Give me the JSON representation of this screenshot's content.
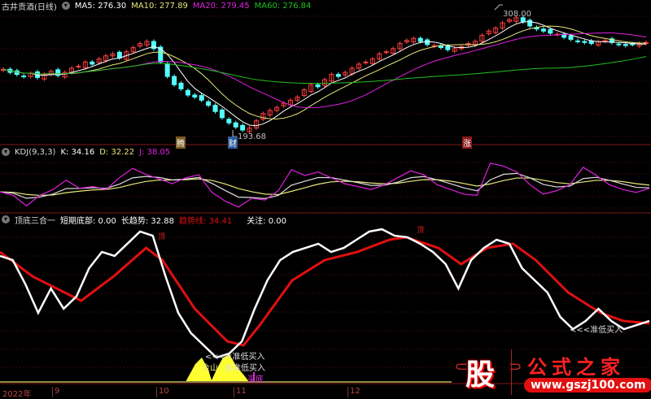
{
  "price_header": {
    "title": "古井贡酒(日线)",
    "ma5": "MA5: 276.30",
    "ma10": "MA10: 277.89",
    "ma20": "MA20: 279.45",
    "ma60": "MA60: 276.84"
  },
  "kdj_header": {
    "title": "KDJ(9,3,3)",
    "k": "K: 34.16",
    "d": "D: 32.22",
    "j": "J: 38.05"
  },
  "ind_header": {
    "title": "顶底三合一",
    "short": "短期底部: 0.00",
    "long": "长趋势: 32.88",
    "trend": "趋势线: 34.41",
    "focus": "关注: 0.00"
  },
  "markers": {
    "high": "308.00",
    "low": "193.68",
    "tag1": "腾",
    "tag2": "财",
    "tag3": "涨",
    "top1": "顶",
    "top2": "顶",
    "buy1": "<<<<准低买入",
    "buy2": "金山",
    "buy3": "金准低买入",
    "buy4": "买底",
    "buy5": "<<<准低买入"
  },
  "axis": {
    "labels": [
      "2022年",
      "9",
      "10",
      "11",
      "12"
    ]
  },
  "logo": {
    "char": "股",
    "name": "公式之家",
    "url": "www.gszj100.com"
  },
  "colors": {
    "up": "#ff4040",
    "down": "#54ffff",
    "ma5": "#ffffff",
    "ma10": "#e8e87a",
    "ma20": "#e020e0",
    "ma60": "#20c020",
    "trend": "#e01010"
  },
  "chart_data": {
    "type": "line",
    "closes": [
      255,
      252,
      250,
      248,
      251,
      247,
      250,
      253,
      249,
      252,
      256,
      258,
      262,
      260,
      265,
      268,
      270,
      266,
      272,
      276,
      280,
      282,
      275,
      262,
      248,
      240,
      236,
      230,
      228,
      225,
      220,
      214,
      208,
      203,
      199,
      196,
      198,
      205,
      212,
      215,
      218,
      222,
      225,
      228,
      235,
      240,
      238,
      245,
      250,
      248,
      252,
      256,
      260,
      262,
      265,
      270,
      272,
      275,
      280,
      283,
      285,
      282,
      279,
      278,
      276,
      274,
      275,
      277,
      280,
      282,
      288,
      292,
      295,
      300,
      303,
      305,
      301,
      297,
      294,
      292,
      290,
      289,
      286,
      284,
      282,
      281,
      280,
      282,
      283,
      281,
      279,
      278,
      279,
      280,
      281
    ],
    "price_range": [
      193.68,
      308.0
    ],
    "kdj_j": [
      36,
      30,
      12,
      30,
      40,
      56,
      42,
      45,
      40,
      60,
      76,
      66,
      58,
      50,
      60,
      65,
      35,
      20,
      10,
      25,
      22,
      38,
      74,
      64,
      70,
      60,
      50,
      45,
      40,
      48,
      60,
      72,
      65,
      48,
      40,
      32,
      30,
      85,
      80,
      70,
      48,
      32,
      38,
      48,
      78,
      64,
      48,
      40,
      35,
      42
    ],
    "white": [
      81.6,
      78.9,
      63.2,
      44.7,
      60.5,
      47.4,
      55.3,
      73.7,
      84.2,
      81.6,
      89.5,
      97.4,
      94.7,
      68.4,
      44.7,
      31.6,
      23.7,
      15.8,
      18.4,
      26.3,
      47.4,
      65.8,
      78.9,
      84.2,
      86.8,
      89.5,
      84.2,
      86.8,
      92.1,
      97.4,
      98.9,
      94.7,
      93.7,
      89.5,
      84.2,
      76.3,
      60.5,
      78.9,
      86.8,
      92.1,
      89.5,
      73.7,
      65.8,
      57.9,
      42.1,
      34.2,
      39.5,
      47.4,
      39.5,
      34.2,
      36.8,
      39.5
    ],
    "red": [
      [
        0,
        84.2
      ],
      [
        5,
        68.4
      ],
      [
        12.5,
        52.6
      ],
      [
        17.5,
        68.4
      ],
      [
        22.5,
        86.8
      ],
      [
        25,
        78.9
      ],
      [
        30,
        47.4
      ],
      [
        35,
        26.3
      ],
      [
        37.5,
        23.7
      ],
      [
        40,
        36.8
      ],
      [
        45,
        65.8
      ],
      [
        50,
        78.9
      ],
      [
        55,
        84.2
      ],
      [
        60,
        92.1
      ],
      [
        62.5,
        93.7
      ],
      [
        67.5,
        86.8
      ],
      [
        71,
        76.3
      ],
      [
        75,
        86.8
      ],
      [
        79,
        89.5
      ],
      [
        82.5,
        78.9
      ],
      [
        87.5,
        57.9
      ],
      [
        92.5,
        44.7
      ],
      [
        96,
        39.5
      ],
      [
        100,
        37.9
      ]
    ]
  }
}
